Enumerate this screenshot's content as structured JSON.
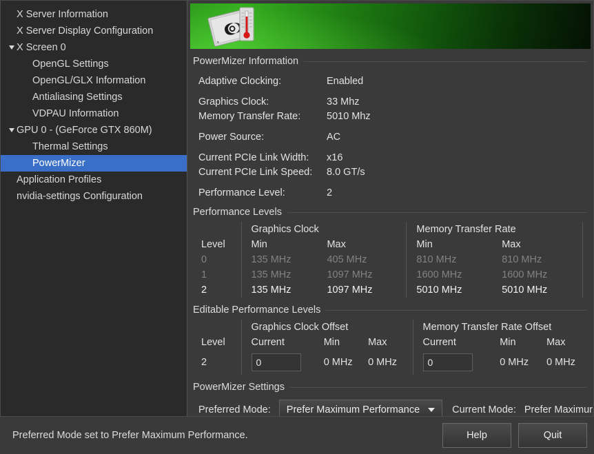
{
  "sidebar": {
    "items": [
      {
        "label": "X Server Information",
        "indent": 1,
        "expandable": false,
        "selected": false
      },
      {
        "label": "X Server Display Configuration",
        "indent": 1,
        "expandable": false,
        "selected": false
      },
      {
        "label": "X Screen 0",
        "indent": 0,
        "expandable": true,
        "selected": false
      },
      {
        "label": "OpenGL Settings",
        "indent": 2,
        "expandable": false,
        "selected": false
      },
      {
        "label": "OpenGL/GLX Information",
        "indent": 2,
        "expandable": false,
        "selected": false
      },
      {
        "label": "Antialiasing Settings",
        "indent": 2,
        "expandable": false,
        "selected": false
      },
      {
        "label": "VDPAU Information",
        "indent": 2,
        "expandable": false,
        "selected": false
      },
      {
        "label": "GPU 0 - (GeForce GTX 860M)",
        "indent": 0,
        "expandable": true,
        "selected": false
      },
      {
        "label": "Thermal Settings",
        "indent": 2,
        "expandable": false,
        "selected": false
      },
      {
        "label": "PowerMizer",
        "indent": 2,
        "expandable": false,
        "selected": true
      },
      {
        "label": "Application Profiles",
        "indent": 1,
        "expandable": false,
        "selected": false
      },
      {
        "label": "nvidia-settings Configuration",
        "indent": 1,
        "expandable": false,
        "selected": false
      }
    ]
  },
  "banner": {
    "icon": "nvidia-card-thermometer-icon"
  },
  "sections": {
    "info_title": "PowerMizer Information",
    "levels_title": "Performance Levels",
    "editable_title": "Editable Performance Levels",
    "settings_title": "PowerMizer Settings"
  },
  "info": [
    {
      "key": "Adaptive Clocking:",
      "value": "Enabled",
      "gap": false
    },
    {
      "key": "Graphics Clock:",
      "value": "33 Mhz",
      "gap": true
    },
    {
      "key": "Memory Transfer Rate:",
      "value": "5010 Mhz",
      "gap": false
    },
    {
      "key": "Power Source:",
      "value": "AC",
      "gap": true
    },
    {
      "key": "Current PCIe Link Width:",
      "value": "x16",
      "gap": true
    },
    {
      "key": "Current PCIe Link Speed:",
      "value": "8.0 GT/s",
      "gap": false
    },
    {
      "key": "Performance Level:",
      "value": "2",
      "gap": true
    }
  ],
  "perf_levels": {
    "group_headers": [
      "Graphics Clock",
      "Memory Transfer Rate"
    ],
    "columns": [
      "Level",
      "Min",
      "Max",
      "Min",
      "Max"
    ],
    "rows": [
      {
        "level": "0",
        "gc_min": "135 MHz",
        "gc_max": "405 MHz",
        "mtr_min": "810 MHz",
        "mtr_max": "810 MHz",
        "active": false
      },
      {
        "level": "1",
        "gc_min": "135 MHz",
        "gc_max": "1097 MHz",
        "mtr_min": "1600 MHz",
        "mtr_max": "1600 MHz",
        "active": false
      },
      {
        "level": "2",
        "gc_min": "135 MHz",
        "gc_max": "1097 MHz",
        "mtr_min": "5010 MHz",
        "mtr_max": "5010 MHz",
        "active": true
      }
    ]
  },
  "editable_levels": {
    "group_headers": [
      "Graphics Clock Offset",
      "Memory Transfer Rate Offset"
    ],
    "columns": [
      "Level",
      "Current",
      "Min",
      "Max",
      "Current",
      "Min",
      "Max"
    ],
    "row": {
      "level": "2",
      "gc_current": "0",
      "gc_min": "0 MHz",
      "gc_max": "0 MHz",
      "mtr_current": "0",
      "mtr_min": "0 MHz",
      "mtr_max": "0 MHz"
    }
  },
  "settings": {
    "preferred_mode_label": "Preferred Mode:",
    "preferred_mode_value": "Prefer Maximum Performance",
    "current_mode_label": "Current Mode:",
    "current_mode_value": "Prefer Maximur"
  },
  "footer": {
    "status": "Preferred Mode set to Prefer Maximum Performance.",
    "help_label": "Help",
    "quit_label": "Quit"
  },
  "colors": {
    "selection_blue": "#3a6fc8",
    "banner_green": "#36b020",
    "panel_bg": "#3a3a3a",
    "sidebar_bg": "#2a2a2a"
  }
}
